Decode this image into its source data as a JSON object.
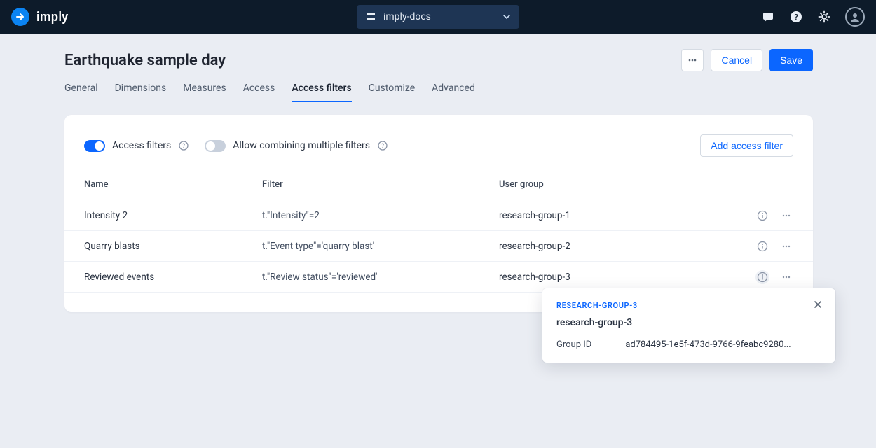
{
  "header": {
    "logo": "imply",
    "project": "imply-docs"
  },
  "page": {
    "title": "Earthquake sample day",
    "actions": {
      "cancel": "Cancel",
      "save": "Save"
    },
    "tabs": [
      {
        "label": "General"
      },
      {
        "label": "Dimensions"
      },
      {
        "label": "Measures"
      },
      {
        "label": "Access"
      },
      {
        "label": "Access filters"
      },
      {
        "label": "Customize"
      },
      {
        "label": "Advanced"
      }
    ]
  },
  "panel": {
    "toggle1": "Access filters",
    "toggle2": "Allow combining multiple filters",
    "add_button": "Add access filter",
    "columns": {
      "name": "Name",
      "filter": "Filter",
      "group": "User group"
    },
    "rows": [
      {
        "name": "Intensity 2",
        "filter": "t.\"Intensity\"=2",
        "group": "research-group-1"
      },
      {
        "name": "Quarry blasts",
        "filter": "t.\"Event type\"='quarry blast'",
        "group": "research-group-2"
      },
      {
        "name": "Reviewed events",
        "filter": "t.\"Review status\"='reviewed'",
        "group": "research-group-3"
      }
    ]
  },
  "popover": {
    "eyebrow": "RESEARCH-GROUP-3",
    "title": "research-group-3",
    "field_label": "Group ID",
    "field_value": "ad784495-1e5f-473d-9766-9feabc9280..."
  }
}
